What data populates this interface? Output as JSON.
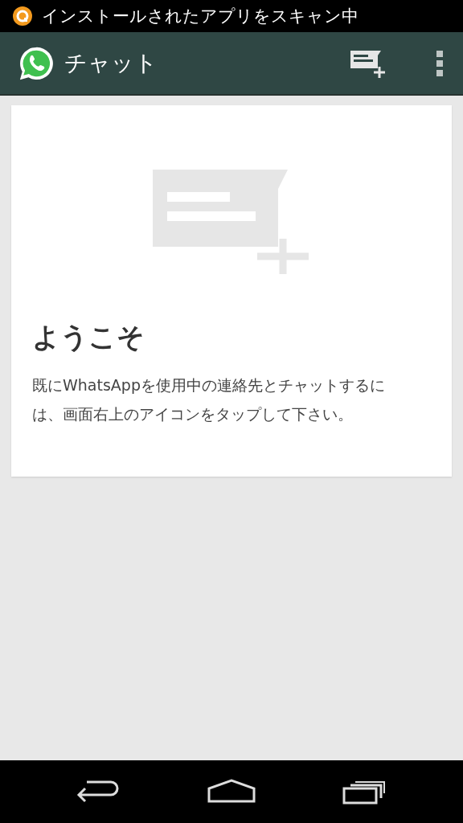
{
  "status_bar": {
    "notification": "インストールされたアプリをスキャン中"
  },
  "app_bar": {
    "title": "チャット"
  },
  "welcome_card": {
    "title": "ようこそ",
    "message": "既にWhatsAppを使用中の連絡先とチャットするには、画面右上のアイコンをタップして下さい。"
  }
}
